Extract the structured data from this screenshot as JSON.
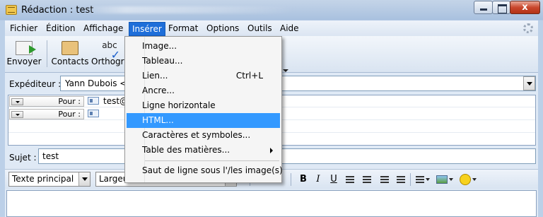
{
  "window": {
    "title": "Rédaction : test",
    "close_label": "x"
  },
  "menubar": {
    "items": [
      "Fichier",
      "Édition",
      "Affichage",
      "Insérer",
      "Format",
      "Options",
      "Outils",
      "Aide"
    ]
  },
  "toolbar": {
    "send_label": "Envoyer",
    "contacts_label": "Contacts",
    "spell_label": "Orthographe",
    "spell_icon_text": "abc"
  },
  "sender": {
    "label": "Expéditeur :",
    "value": "Yann Dubois <ya"
  },
  "recipients": [
    {
      "type": "Pour :",
      "value": "test@a"
    },
    {
      "type": "Pour :",
      "value": ""
    }
  ],
  "subject": {
    "label": "Sujet :",
    "value": "test"
  },
  "format_bar": {
    "paragraph_style": "Texte principal",
    "font": "Largeur variable",
    "bold": "B",
    "italic": "I",
    "underline": "U"
  },
  "insert_menu": {
    "items": [
      {
        "label": "Image...",
        "shortcut": ""
      },
      {
        "label": "Tableau...",
        "shortcut": ""
      },
      {
        "label": "Lien...",
        "shortcut": "Ctrl+L"
      },
      {
        "label": "Ancre...",
        "shortcut": ""
      },
      {
        "label": "Ligne horizontale",
        "shortcut": ""
      },
      {
        "label": "HTML...",
        "shortcut": "",
        "highlighted": true
      },
      {
        "label": "Caractères et symboles...",
        "shortcut": ""
      },
      {
        "label": "Table des matières...",
        "shortcut": "",
        "submenu": true
      },
      {
        "label": "Saut de ligne sous l'/les image(s)",
        "shortcut": ""
      }
    ]
  },
  "colors": {
    "menu_highlight": "#3399ff",
    "active_menu": "#1e6ed9",
    "window_frame": "#a9c1df"
  }
}
